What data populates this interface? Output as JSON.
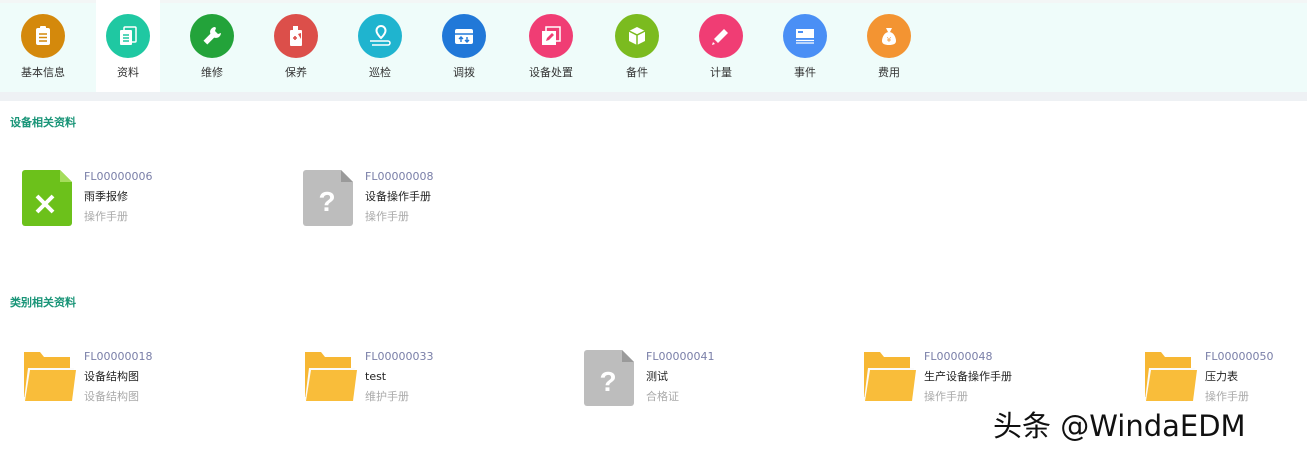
{
  "nav": {
    "items": [
      {
        "label": "基本信息",
        "icon": "clipboard-icon",
        "color": "#d4890c"
      },
      {
        "label": "资料",
        "icon": "documents-icon",
        "color": "#1fc8a2"
      },
      {
        "label": "维修",
        "icon": "wrench-icon",
        "color": "#23a33a"
      },
      {
        "label": "保养",
        "icon": "oil-can-icon",
        "color": "#dc4f4a"
      },
      {
        "label": "巡检",
        "icon": "location-route-icon",
        "color": "#1fb4cf"
      },
      {
        "label": "调拨",
        "icon": "transfer-box-icon",
        "color": "#2178d8"
      },
      {
        "label": "设备处置",
        "icon": "edit-icon",
        "color": "#f03d74"
      },
      {
        "label": "备件",
        "icon": "package-icon",
        "color": "#7bbb1f"
      },
      {
        "label": "计量",
        "icon": "ruler-icon",
        "color": "#f03d74"
      },
      {
        "label": "事件",
        "icon": "card-icon",
        "color": "#4a8ff5"
      },
      {
        "label": "费用",
        "icon": "money-bag-icon",
        "color": "#f39432"
      }
    ],
    "active": 1
  },
  "sections": [
    {
      "title": "设备相关资料",
      "files": [
        {
          "code": "FL00000006",
          "name": "雨季报修",
          "type": "操作手册",
          "icon": "excel-file-icon"
        },
        {
          "code": "FL00000008",
          "name": "设备操作手册",
          "type": "操作手册",
          "icon": "unknown-file-icon"
        }
      ]
    },
    {
      "title": "类别相关资料",
      "files": [
        {
          "code": "FL00000018",
          "name": "设备结构图",
          "type": "设备结构图",
          "icon": "folder-icon"
        },
        {
          "code": "FL00000033",
          "name": "test",
          "type": "维护手册",
          "icon": "folder-icon"
        },
        {
          "code": "FL00000041",
          "name": "测试",
          "type": "合格证",
          "icon": "unknown-file-icon"
        },
        {
          "code": "FL00000048",
          "name": "生产设备操作手册",
          "type": "操作手册",
          "icon": "folder-icon"
        },
        {
          "code": "FL00000050",
          "name": "压力表",
          "type": "操作手册",
          "icon": "folder-icon"
        }
      ]
    }
  ],
  "watermark": "头条 @WindaEDM"
}
